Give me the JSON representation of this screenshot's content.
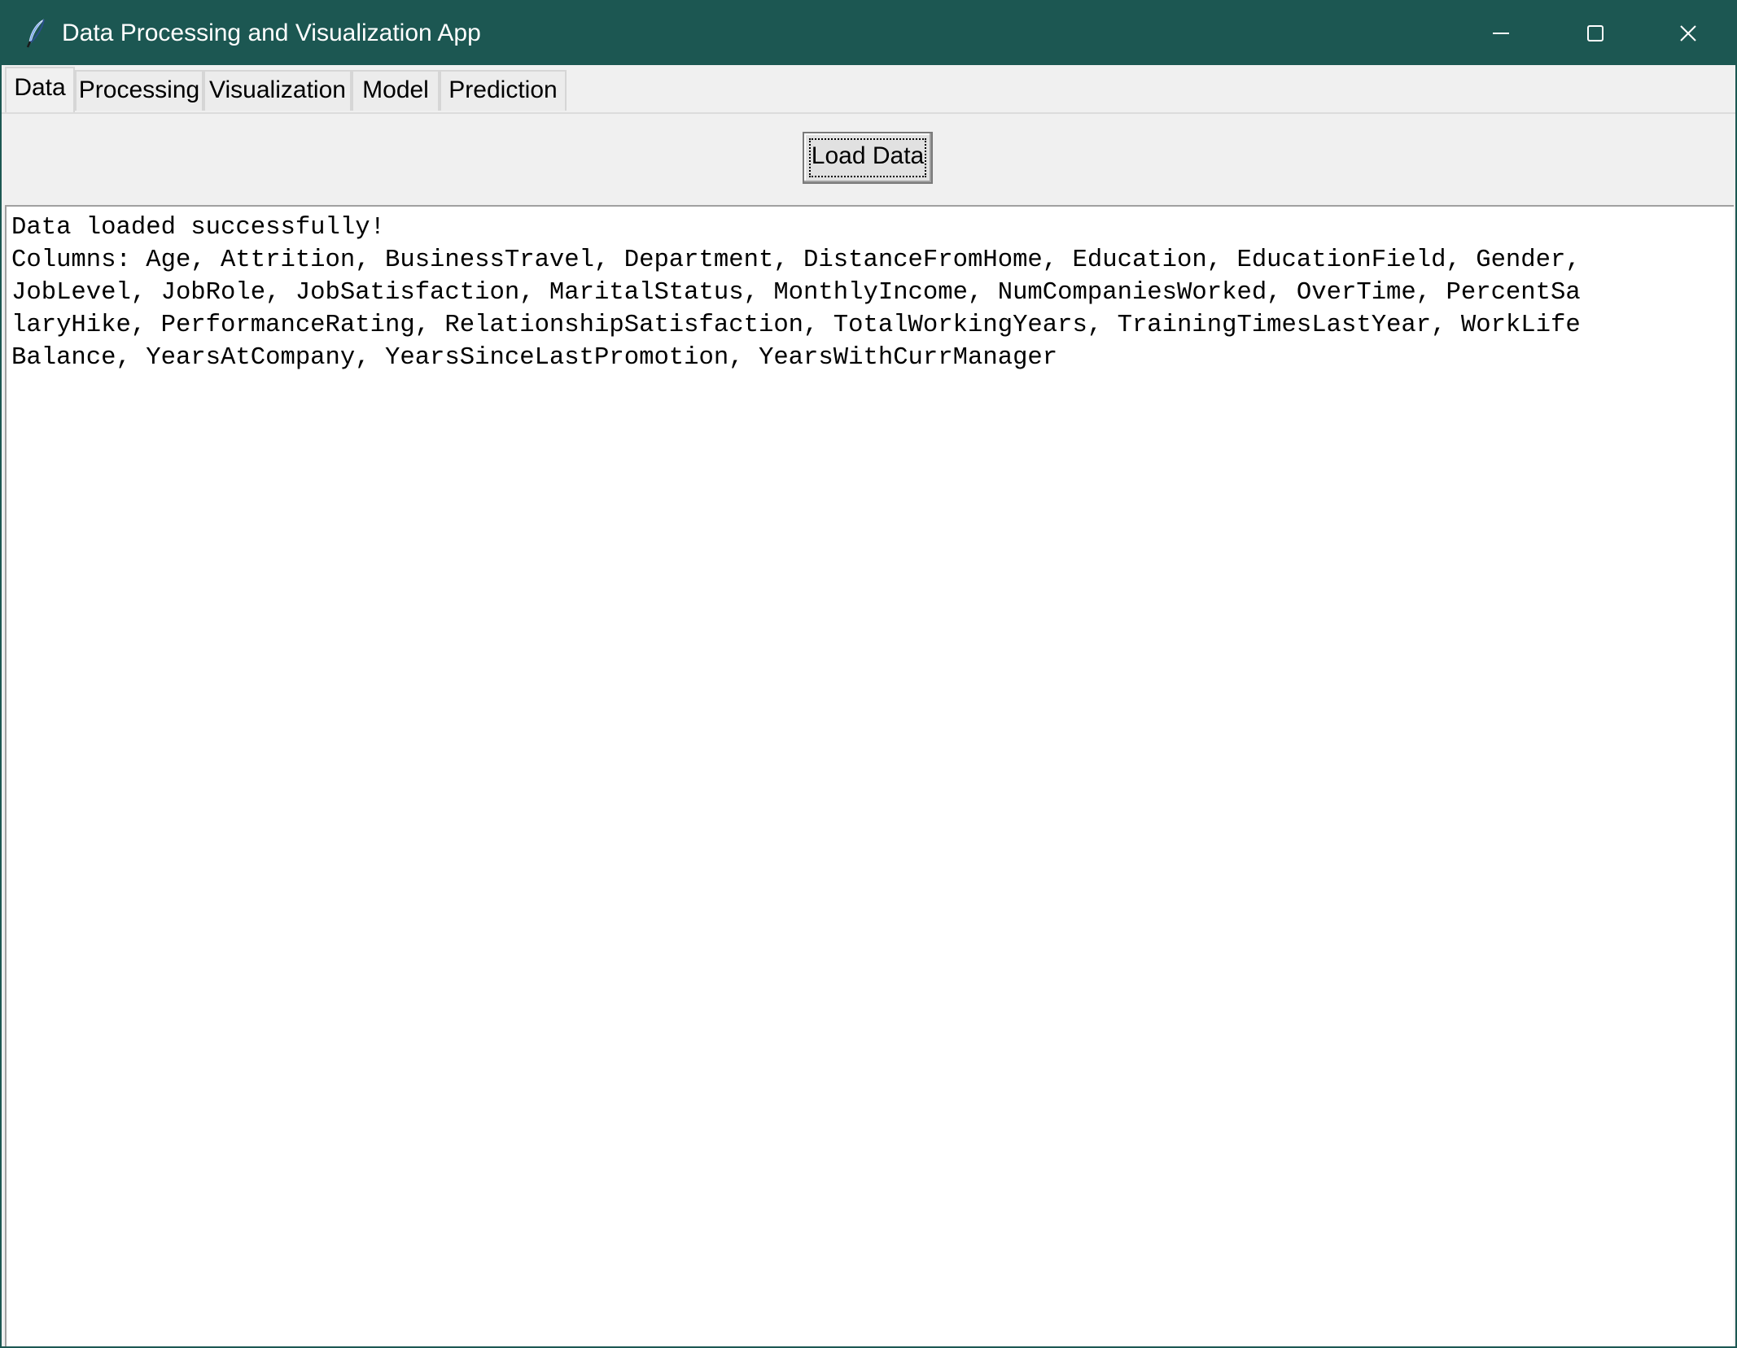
{
  "window": {
    "title": "Data Processing and Visualization App",
    "app_icon": "feather-icon",
    "controls": {
      "minimize_icon": "minimize-icon",
      "maximize_icon": "maximize-icon",
      "close_icon": "close-icon"
    },
    "titlebar_color": "#1c5752"
  },
  "tabs": [
    {
      "label": "Data",
      "active": true
    },
    {
      "label": "Processing",
      "active": false
    },
    {
      "label": "Visualization",
      "active": false
    },
    {
      "label": "Model",
      "active": false
    },
    {
      "label": "Prediction",
      "active": false
    }
  ],
  "data_tab": {
    "load_button_label": "Load Data",
    "output_lines": [
      "Data loaded successfully!",
      "Columns: Age, Attrition, BusinessTravel, Department, DistanceFromHome, Education, EducationField, Gender,",
      "JobLevel, JobRole, JobSatisfaction, MaritalStatus, MonthlyIncome, NumCompaniesWorked, OverTime, PercentSa",
      "laryHike, PerformanceRating, RelationshipSatisfaction, TotalWorkingYears, TrainingTimesLastYear, WorkLife",
      "Balance, YearsAtCompany, YearsSinceLastPromotion, YearsWithCurrManager"
    ]
  }
}
